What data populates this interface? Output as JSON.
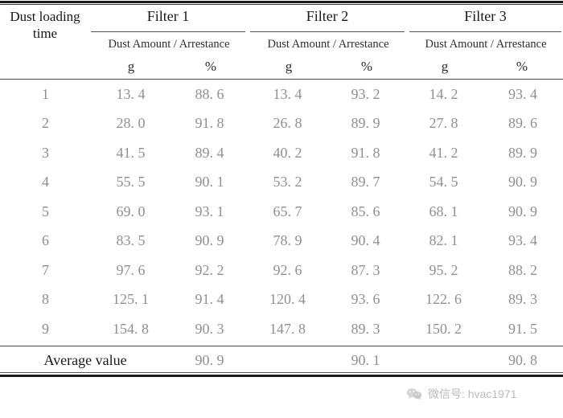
{
  "table": {
    "stub_header": "Dust loading\ntime",
    "stub_header_line1": "Dust loading",
    "stub_header_line2": "time",
    "groups": [
      {
        "title": "Filter 1",
        "subheader": "Dust Amount / Arrestance",
        "units": [
          "g",
          "%"
        ]
      },
      {
        "title": "Filter 2",
        "subheader": "Dust Amount / Arrestance",
        "units": [
          "g",
          "%"
        ]
      },
      {
        "title": "Filter 3",
        "subheader": "Dust Amount / Arrestance",
        "units": [
          "g",
          "%"
        ]
      }
    ],
    "rows": [
      {
        "index": "1",
        "f1_amount": "13. 4",
        "f1_arrest": "88. 6",
        "f2_amount": "13. 4",
        "f2_arrest": "93. 2",
        "f3_amount": "14. 2",
        "f3_arrest": "93. 4"
      },
      {
        "index": "2",
        "f1_amount": "28. 0",
        "f1_arrest": "91. 8",
        "f2_amount": "26. 8",
        "f2_arrest": "89. 9",
        "f3_amount": "27. 8",
        "f3_arrest": "89. 6"
      },
      {
        "index": "3",
        "f1_amount": "41. 5",
        "f1_arrest": "89. 4",
        "f2_amount": "40. 2",
        "f2_arrest": "91. 8",
        "f3_amount": "41. 2",
        "f3_arrest": "89. 9"
      },
      {
        "index": "4",
        "f1_amount": "55. 5",
        "f1_arrest": "90. 1",
        "f2_amount": "53. 2",
        "f2_arrest": "89. 7",
        "f3_amount": "54. 5",
        "f3_arrest": "90. 9"
      },
      {
        "index": "5",
        "f1_amount": "69. 0",
        "f1_arrest": "93. 1",
        "f2_amount": "65. 7",
        "f2_arrest": "85. 6",
        "f3_amount": "68. 1",
        "f3_arrest": "90. 9"
      },
      {
        "index": "6",
        "f1_amount": "83. 5",
        "f1_arrest": "90. 9",
        "f2_amount": "78. 9",
        "f2_arrest": "90. 4",
        "f3_amount": "82. 1",
        "f3_arrest": "93. 4"
      },
      {
        "index": "7",
        "f1_amount": "97. 6",
        "f1_arrest": "92. 2",
        "f2_amount": "92. 6",
        "f2_arrest": "87. 3",
        "f3_amount": "95. 2",
        "f3_arrest": "88. 2"
      },
      {
        "index": "8",
        "f1_amount": "125. 1",
        "f1_arrest": "91. 4",
        "f2_amount": "120. 4",
        "f2_arrest": "93. 6",
        "f3_amount": "122. 6",
        "f3_arrest": "89. 3"
      },
      {
        "index": "9",
        "f1_amount": "154. 8",
        "f1_arrest": "90. 3",
        "f2_amount": "147. 8",
        "f2_arrest": "89. 3",
        "f3_amount": "150. 2",
        "f3_arrest": "91. 5"
      }
    ],
    "average": {
      "label": "Average value",
      "f1_amount": "",
      "f1_arrest": "90. 9",
      "f2_amount": "",
      "f2_arrest": "90. 1",
      "f3_amount": "",
      "f3_arrest": "90. 8"
    }
  },
  "watermark": {
    "icon": "wechat-icon",
    "text": "微信号: hvac1971"
  },
  "colors": {
    "rule_dark": "#1c1c1c",
    "rule_thin": "#4a4a4a",
    "header_text": "#16181a",
    "data_text": "#8e9094",
    "watermark_text": "#b9bbbe",
    "background": "#ffffff"
  }
}
